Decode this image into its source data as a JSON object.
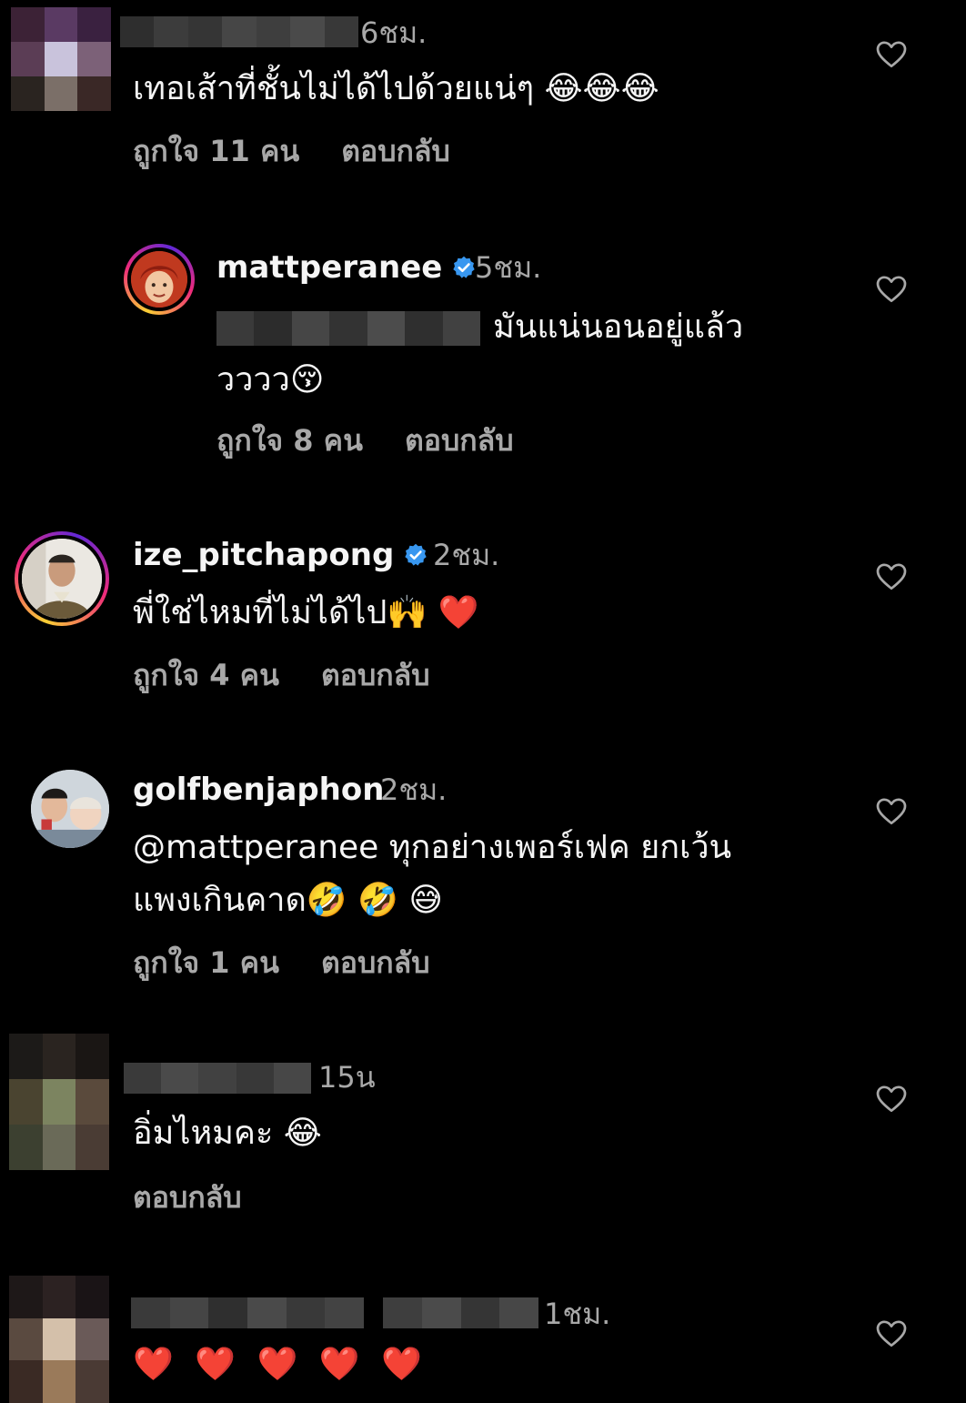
{
  "comments": [
    {
      "username": "",
      "time": "6ชม.",
      "text": "เทอเส้าที่ชั้นไม่ได้ไปด้วยแน่ๆ 😂😂😂",
      "likes": "ถูกใจ 11 คน",
      "reply": "ตอบกลับ"
    },
    {
      "username": "mattperanee",
      "time": "5ชม.",
      "text_line1": "มันแน่นอนอยู่แล้ว",
      "text_line2": "วววว😚",
      "likes": "ถูกใจ 8 คน",
      "reply": "ตอบกลับ"
    },
    {
      "username": "ize_pitchapong",
      "time": "2ชม.",
      "text": "พี่ใช่ไหมที่ไม่ได้ไป🙌 ❤️",
      "likes": "ถูกใจ 4 คน",
      "reply": "ตอบกลับ"
    },
    {
      "username": "golfbenjaphon",
      "time": "2ชม.",
      "text_line1": "@mattperanee ทุกอย่างเพอร์เฟค ยกเว้น",
      "text_line2": "แพงเกินคาด🤣 🤣 😅",
      "likes": "ถูกใจ 1 คน",
      "reply": "ตอบกลับ"
    },
    {
      "username": "",
      "time": "15น",
      "text": "อิ่มไหมคะ 😂",
      "reply": "ตอบกลับ"
    },
    {
      "username": "",
      "time": "1ชม.",
      "text": "❤️ ❤️ ❤️ ❤️ ❤️"
    }
  ],
  "icons": {
    "heart": "heart-outline-icon",
    "verified": "verified-badge-icon"
  },
  "colors": {
    "background": "#000000",
    "primary_text": "#f5f5f5",
    "secondary_text": "#a8a8a8",
    "verified_blue": "#3897f0"
  }
}
